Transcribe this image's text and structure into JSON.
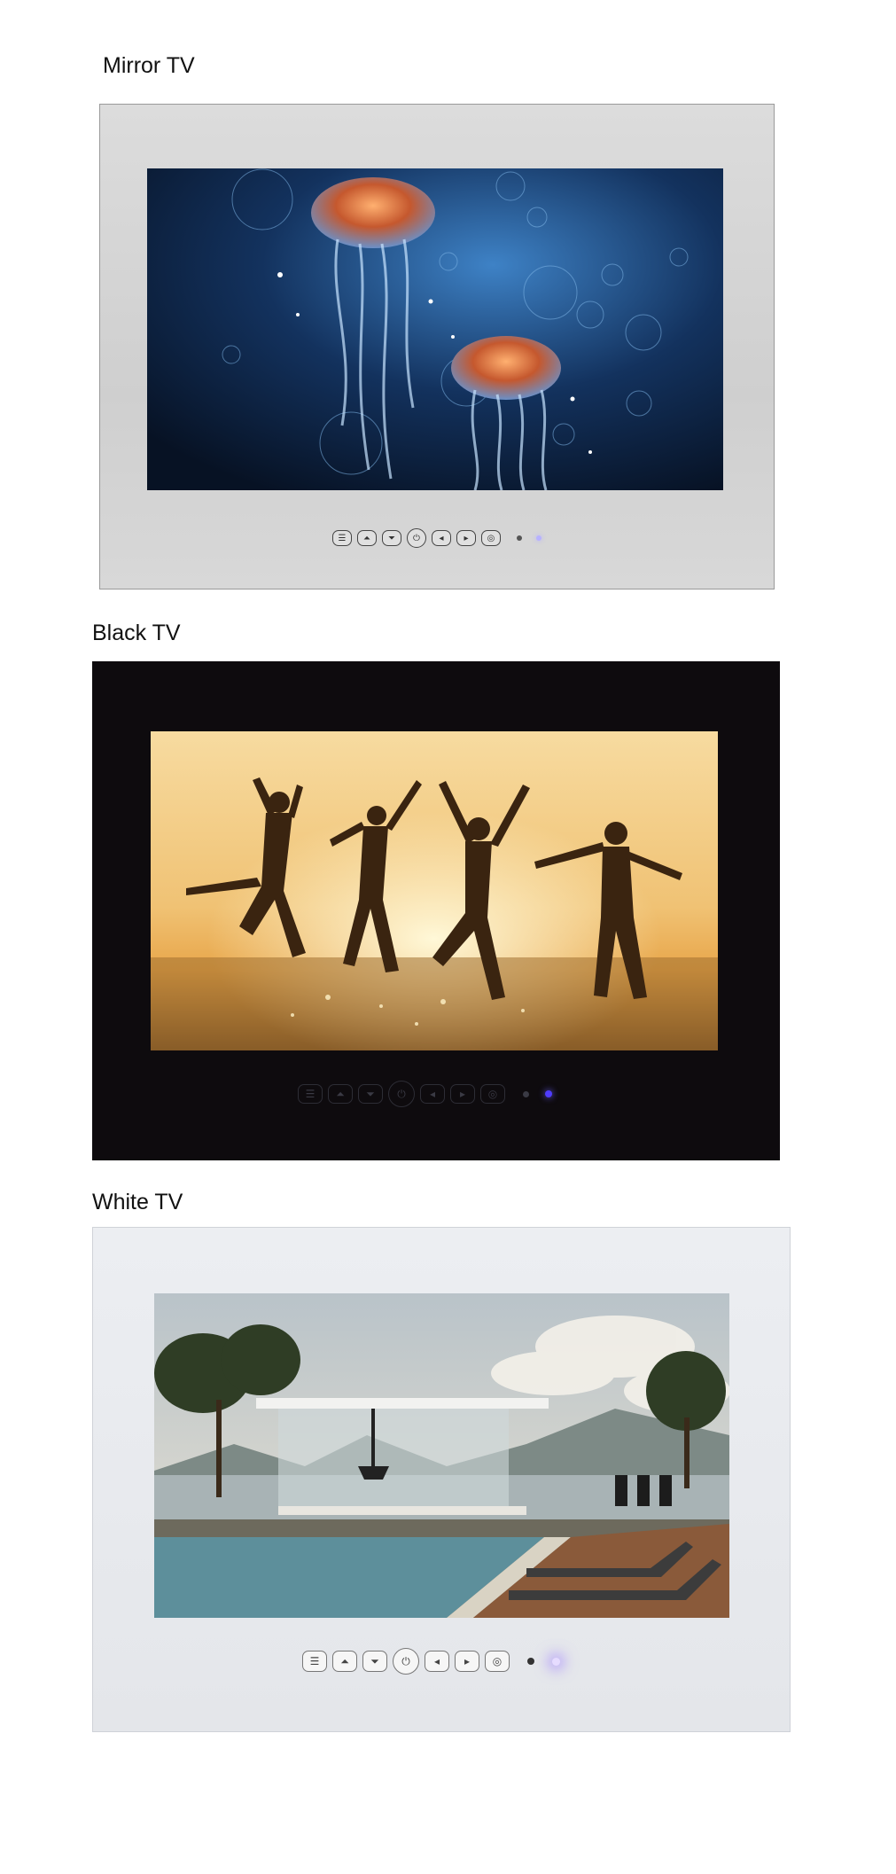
{
  "sections": [
    {
      "id": "mirror",
      "caption": "Mirror TV",
      "screen_scene": "jellyfish underwater",
      "buttons": [
        "menu-icon",
        "input-icon",
        "channel-icon",
        "power-icon",
        "volume-down-icon",
        "volume-up-icon",
        "settings-icon"
      ],
      "indicator_lit_color": "#b7b2ff",
      "bezel_color": "#d6d6d6"
    },
    {
      "id": "black",
      "caption": "Black TV",
      "screen_scene": "people jumping on beach at sunset",
      "buttons": [
        "menu-icon",
        "input-icon",
        "channel-icon",
        "power-icon",
        "volume-down-icon",
        "volume-up-icon",
        "settings-icon"
      ],
      "indicator_lit_color": "#4f3cff",
      "bezel_color": "#0e0b0e"
    },
    {
      "id": "white",
      "caption": "White TV",
      "screen_scene": "pool villa by the lake",
      "buttons": [
        "menu-icon",
        "channel-up-icon",
        "channel-down-icon",
        "power-icon",
        "volume-down-icon",
        "volume-up-icon",
        "settings-icon"
      ],
      "indicator_lit_color": "#d9c8ff",
      "bezel_color": "#e8eaee"
    }
  ]
}
